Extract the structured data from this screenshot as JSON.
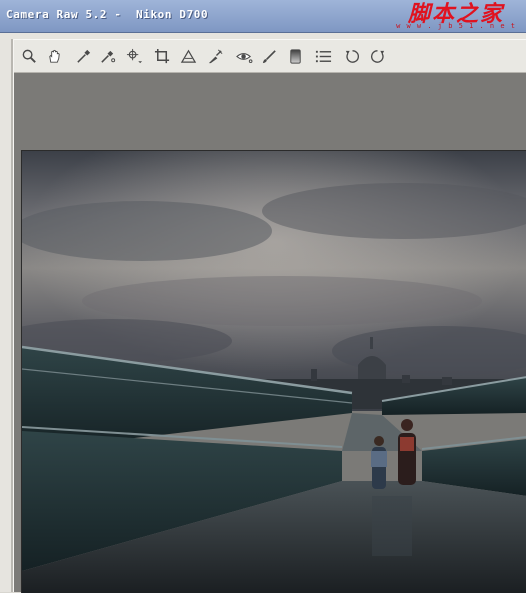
{
  "window": {
    "title": "Camera Raw 5.2 -  Nikon D700",
    "watermark_main": "脚本之家",
    "watermark_sub": "w w w . j b 5 1 . n e t"
  },
  "toolbar": {
    "tools": [
      {
        "name": "zoom-tool",
        "icon": "magnifier-icon"
      },
      {
        "name": "hand-tool",
        "icon": "hand-icon"
      },
      {
        "name": "white-balance-tool",
        "icon": "eyedropper-icon"
      },
      {
        "name": "color-sampler-tool",
        "icon": "color-sampler-icon"
      },
      {
        "name": "targeted-adjustment-tool",
        "icon": "target-icon"
      },
      {
        "name": "crop-tool",
        "icon": "crop-icon"
      },
      {
        "name": "straighten-tool",
        "icon": "straighten-icon"
      },
      {
        "name": "spot-removal-tool",
        "icon": "spot-removal-icon"
      },
      {
        "name": "red-eye-removal-tool",
        "icon": "red-eye-icon"
      },
      {
        "name": "adjustment-brush-tool",
        "icon": "brush-icon"
      },
      {
        "name": "graduated-filter-tool",
        "icon": "graduated-filter-icon"
      },
      {
        "name": "preferences-button",
        "icon": "list-icon"
      },
      {
        "name": "rotate-ccw-button",
        "icon": "rotate-left-icon"
      },
      {
        "name": "rotate-cw-button",
        "icon": "rotate-right-icon"
      }
    ]
  },
  "colors": {
    "titlebar": "#8aa1cb",
    "watermark": "#e0121f",
    "preview_background": "#7b7a77"
  }
}
